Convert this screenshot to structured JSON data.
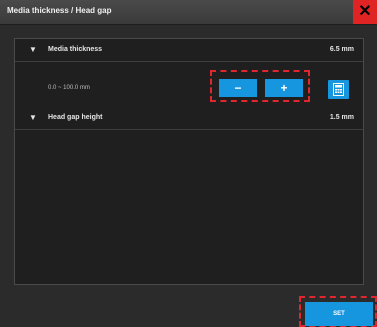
{
  "window": {
    "title": "Media thickness / Head gap",
    "close_glyph": "✕"
  },
  "media_thickness": {
    "label": "Media thickness",
    "value": "6.5 mm",
    "range": "0.0 ~ 100.0 mm",
    "minus_label": "−",
    "plus_label": "+"
  },
  "head_gap": {
    "label": "Head gap height",
    "value": "1.5 mm"
  },
  "footer": {
    "set_label": "SET"
  },
  "icons": {
    "expand": "triangle-down",
    "calculator": "calculator"
  },
  "colors": {
    "accent": "#1796e0",
    "close": "#e02424",
    "highlight": "#e0262e"
  }
}
